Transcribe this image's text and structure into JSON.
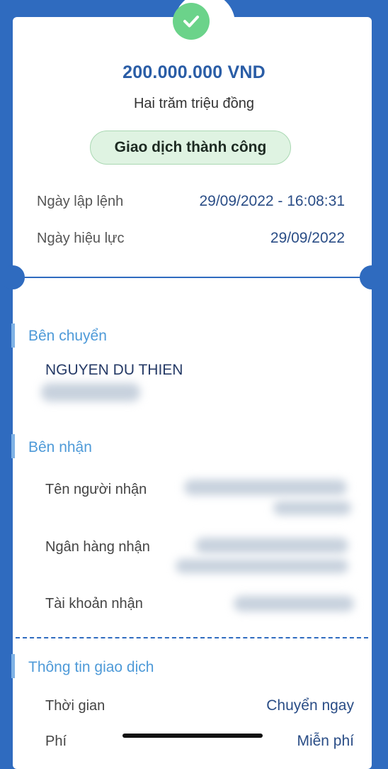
{
  "summary": {
    "amount": "200.000.000 VND",
    "amount_in_words": "Hai trăm triệu đồng",
    "status": "Giao dịch thành công",
    "order_date_label": "Ngày lập lệnh",
    "order_date_value": "29/09/2022 - 16:08:31",
    "effective_date_label": "Ngày hiệu lực",
    "effective_date_value": "29/09/2022"
  },
  "sender": {
    "section_title": "Bên chuyển",
    "name": "NGUYEN DU THIEN"
  },
  "recipient": {
    "section_title": "Bên nhận",
    "name_label": "Tên người nhận",
    "bank_label": "Ngân hàng nhận",
    "account_label": "Tài khoản nhận"
  },
  "transaction": {
    "section_title": "Thông tin giao dịch",
    "time_label": "Thời gian",
    "time_value": "Chuyển ngay",
    "fee_label": "Phí",
    "fee_value": "Miễn phí"
  },
  "colors": {
    "background": "#2f6bbf",
    "amount": "#2a5da6",
    "success": "#6bd38a",
    "section_title": "#4e9ad8"
  },
  "icons": {
    "status": "check-icon"
  }
}
